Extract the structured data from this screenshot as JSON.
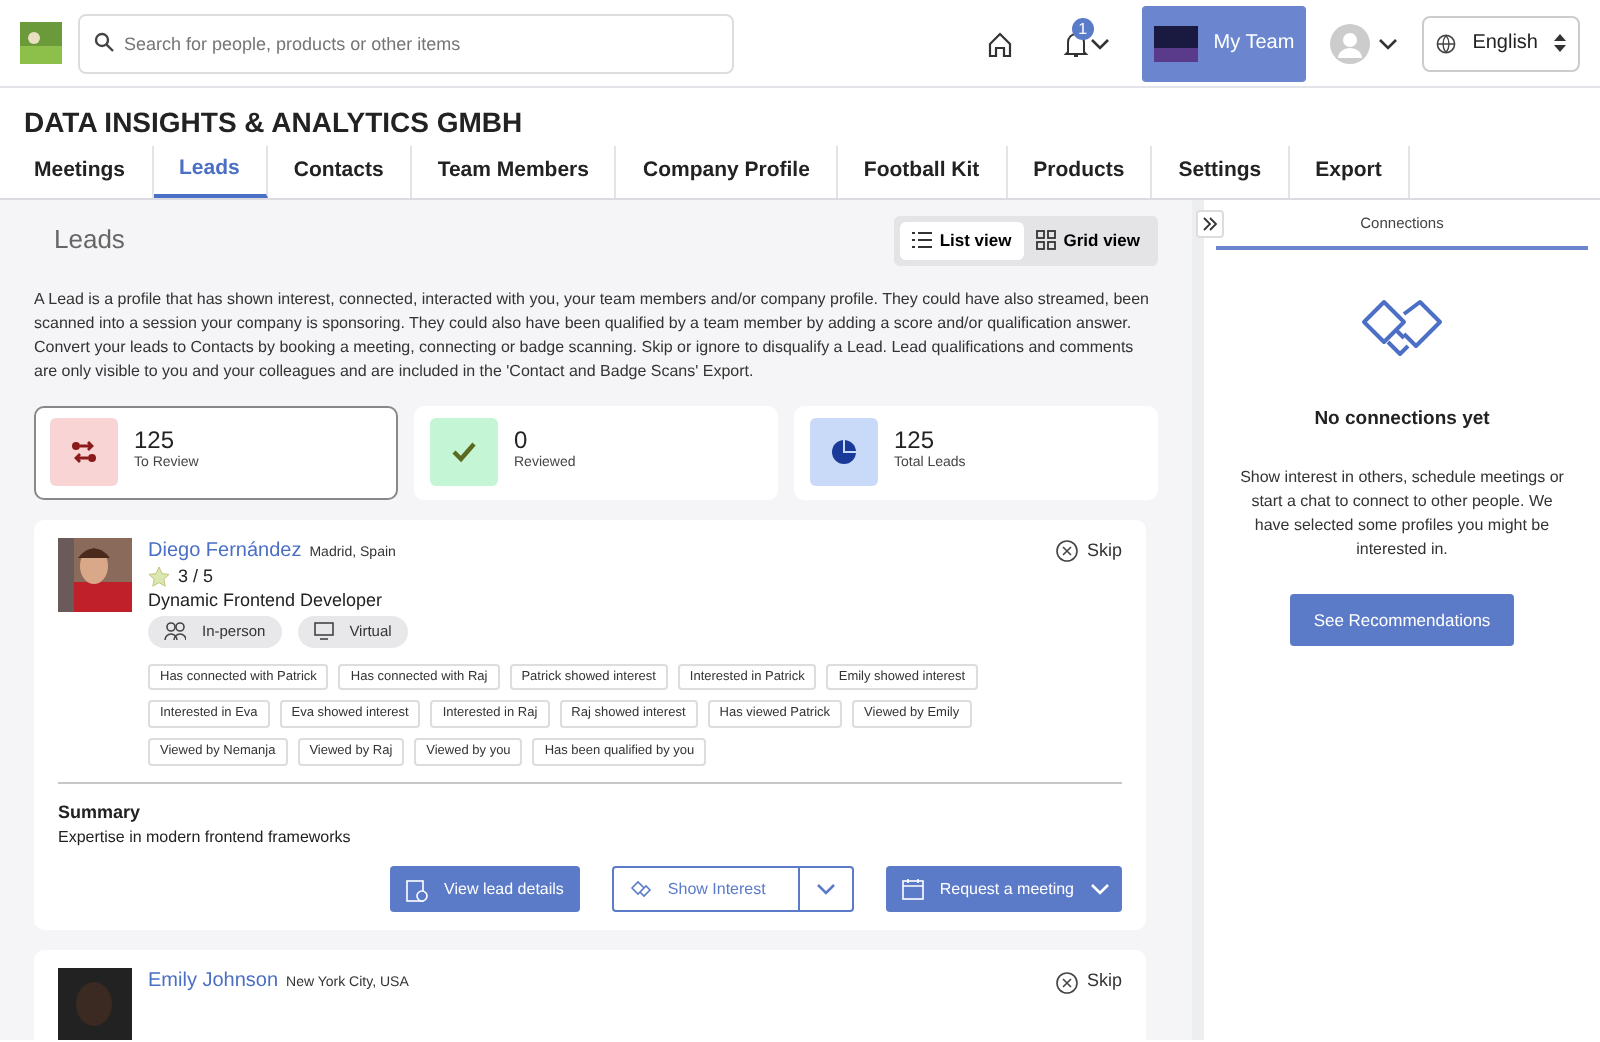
{
  "header": {
    "search": {
      "placeholder": "Search for people, products or other items"
    },
    "notification_count": "1",
    "team_button": "My Team",
    "language": "English"
  },
  "company": {
    "title": "DATA INSIGHTS & ANALYTICS GMBH"
  },
  "tabs": [
    {
      "label": "Meetings",
      "selected": false
    },
    {
      "label": "Leads",
      "selected": true
    },
    {
      "label": "Contacts",
      "selected": false
    },
    {
      "label": "Team Members",
      "selected": false
    },
    {
      "label": "Company Profile",
      "selected": false
    },
    {
      "label": "Football Kit",
      "selected": false
    },
    {
      "label": "Products",
      "selected": false
    },
    {
      "label": "Settings",
      "selected": false
    },
    {
      "label": "Export",
      "selected": false
    }
  ],
  "leads": {
    "title": "Leads",
    "views": [
      {
        "label": "List view",
        "kind": "list",
        "selected": true
      },
      {
        "label": "Grid view",
        "kind": "grid",
        "selected": false
      }
    ],
    "description": "A Lead is a profile that has shown interest, connected, interacted with you, your team members and/or company profile. They could have also streamed, been scanned into a session your company is sponsoring. They could also have been qualified by a team member by adding a score and/or qualification answer. Convert your leads to Contacts by booking a meeting, connecting or badge scanning. Skip or ignore to disqualify a Lead. Lead qualifications and comments are only visible to you and your colleagues and are included in the 'Contact and Badge Scans' Export.",
    "stats": [
      {
        "value": "125",
        "label": "To Review",
        "kind": "review",
        "selected": true
      },
      {
        "value": "0",
        "label": "Reviewed",
        "kind": "reviewed",
        "selected": false
      },
      {
        "value": "125",
        "label": "Total Leads",
        "kind": "total",
        "selected": false
      }
    ],
    "cards": [
      {
        "name": "Diego Fernández",
        "location": "Madrid, Spain",
        "score": "3 / 5",
        "role": "Dynamic Frontend Developer",
        "skip": "Skip",
        "attendance": [
          {
            "label": "In-person",
            "kind": "person"
          },
          {
            "label": "Virtual",
            "kind": "virtual"
          }
        ],
        "tags": [
          "Has connected with Patrick",
          "Has connected with Raj",
          "Patrick showed interest",
          "Interested in Patrick",
          "Emily showed interest",
          "Interested in Eva",
          "Eva showed interest",
          "Interested in Raj",
          "Raj showed interest",
          "Has viewed Patrick",
          "Viewed by Emily",
          "Viewed by Nemanja",
          "Viewed by Raj",
          "Viewed by you",
          "Has been qualified by you"
        ],
        "summary_heading": "Summary",
        "summary": "Expertise in modern frontend frameworks",
        "details_button": "View lead details",
        "interest_button": "Show Interest",
        "meeting_button": "Request a meeting"
      },
      {
        "name": "Emily Johnson",
        "location": "New York City, USA",
        "skip": "Skip"
      }
    ]
  },
  "connections": {
    "tab": "Connections",
    "heading": "No connections yet",
    "text": "Show interest in others, schedule meetings or start a chat to connect to other people. We have selected some profiles you might be interested in.",
    "button": "See Recommendations"
  }
}
